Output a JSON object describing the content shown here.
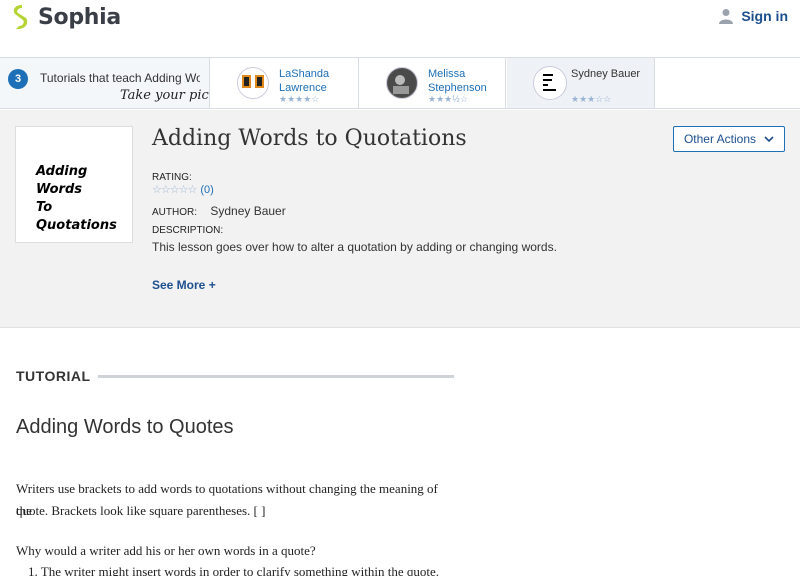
{
  "header": {
    "logo_text": "Sophia",
    "signin_label": "Sign in"
  },
  "picker": {
    "count": "3",
    "title": "Tutorials that teach Adding Words to Quotations",
    "pick_text": "Take your pick:",
    "tutorials": [
      {
        "name": "LaShanda Lawrence",
        "stars": "★★★★☆",
        "rating": 4
      },
      {
        "name": "Melissa Stephenson",
        "stars": "★★★½☆",
        "rating": 3.5
      },
      {
        "name": "Sydney Bauer",
        "stars": "★★★☆☆",
        "rating": 3
      }
    ]
  },
  "lesson": {
    "cover_lines": [
      "Adding",
      "Words",
      "To",
      "Quotations"
    ],
    "title": "Adding Words to Quotations",
    "other_actions_label": "Other Actions",
    "rating_label": "RATING:",
    "rating_stars": "☆☆☆☆☆",
    "rating_count": "(0)",
    "author_label": "AUTHOR:",
    "author_name": "Sydney Bauer",
    "description_label": "DESCRIPTION:",
    "description": "This lesson goes over how to alter a quotation by adding or changing words.",
    "see_more": "See More +"
  },
  "tutorial": {
    "section_heading": "TUTORIAL",
    "subtitle": "Adding Words to Quotes",
    "para1_line1": "Writers use brackets to add words to quotations without changing the meaning of the",
    "para1_line2": "quote. Brackets look like square parentheses. [ ]",
    "para2": "Why would a writer add his or her own words in a quote?",
    "list_item1": "1. The writer might insert words in order to clarify something within the quote."
  },
  "colors": {
    "brand_green": "#b4d334",
    "link_blue": "#1d4f8f",
    "accent_blue": "#1d6fb8"
  }
}
